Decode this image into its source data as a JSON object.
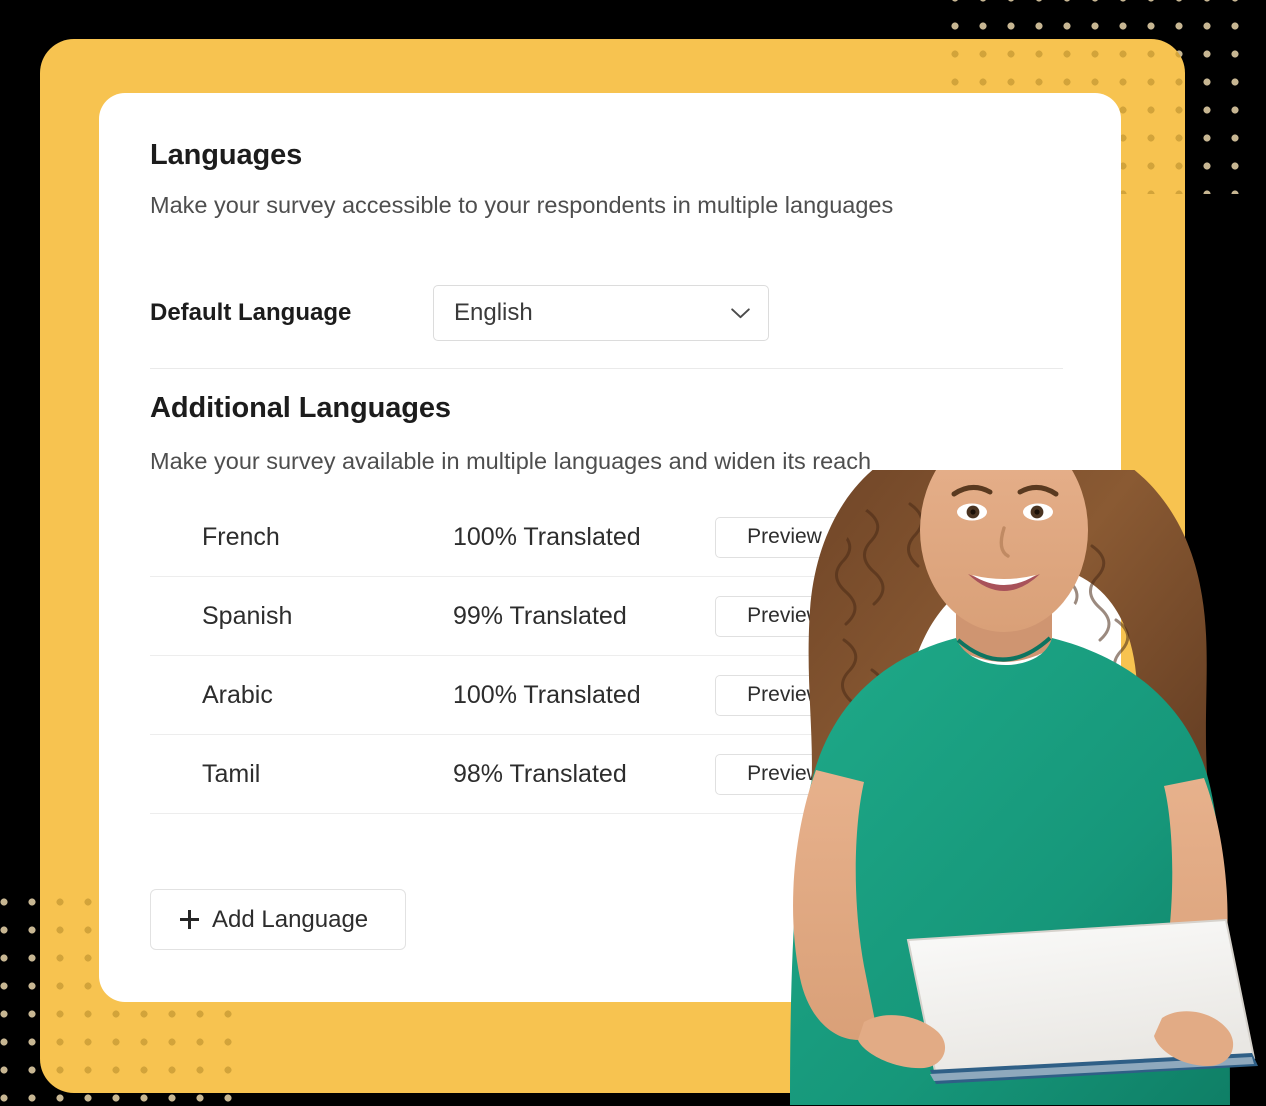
{
  "theme": {
    "page_background": "#000000",
    "panel_accent": "#F7C350",
    "card_background": "#FFFFFF",
    "dot_color": "#E3E3E6",
    "text_primary": "#1C1C1C",
    "text_secondary": "#4E4E4E",
    "border_color": "#E0E0E0",
    "shirt_color": "#19A184"
  },
  "card": {
    "section_title": "Languages",
    "section_subtitle": "Make your survey accessible to your respondents in multiple languages",
    "default_language": {
      "label": "Default Language",
      "value": "English",
      "dropdown_icon": "chevron-down-icon"
    },
    "additional": {
      "title": "Additional Languages",
      "subtitle": "Make your survey available in multiple languages and widen its reach",
      "rows": [
        {
          "language": "French",
          "status": "100% Translated",
          "action": "Preview"
        },
        {
          "language": "Spanish",
          "status": "99% Translated",
          "action": "Preview"
        },
        {
          "language": "Arabic",
          "status": "100% Translated",
          "action": "Preview"
        },
        {
          "language": "Tamil",
          "status": "98% Translated",
          "action": "Preview"
        }
      ]
    },
    "add_language": {
      "label": "Add Language",
      "icon": "plus-icon"
    }
  },
  "decorations": {
    "photo_alt": "smiling woman with curly hair holding a white laptop"
  }
}
